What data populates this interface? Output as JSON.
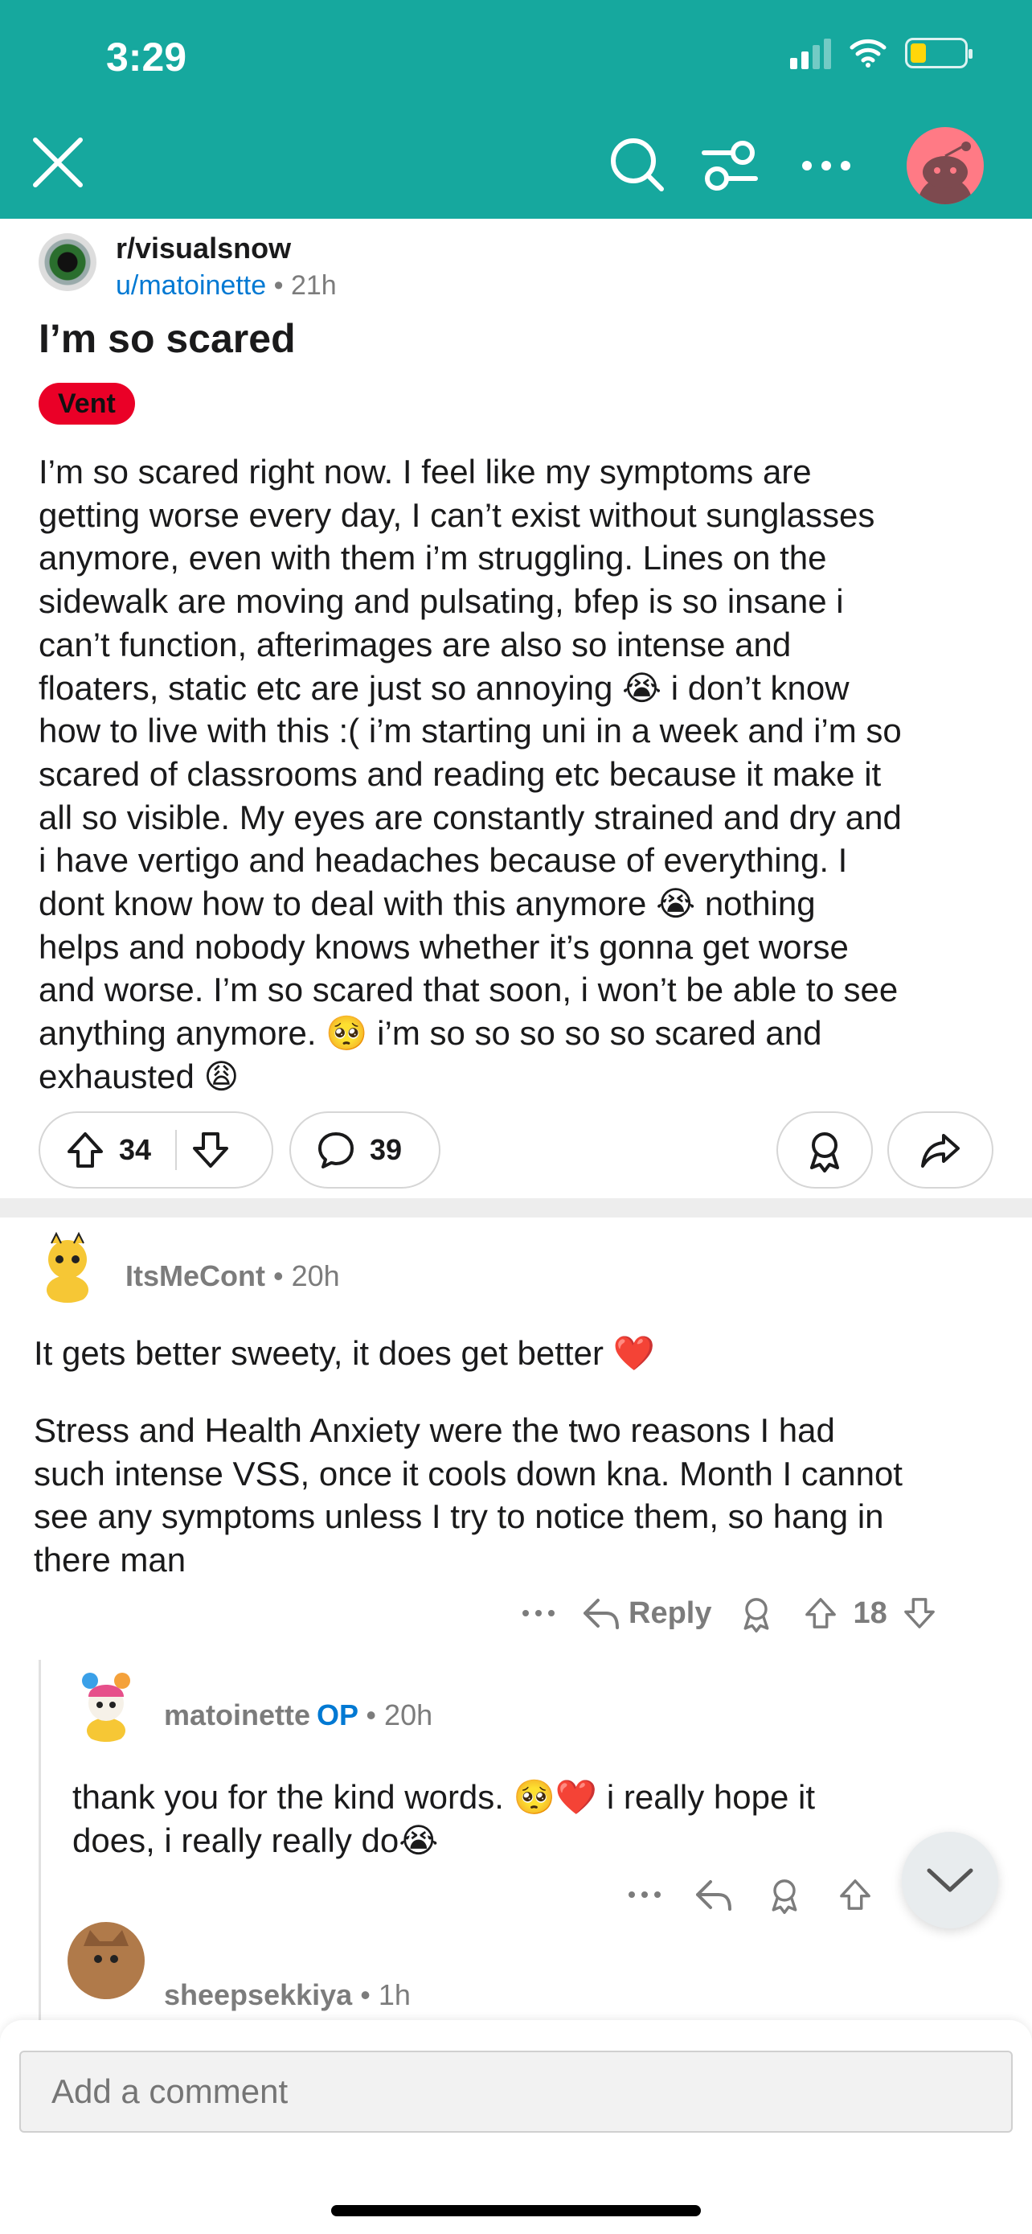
{
  "status_bar": {
    "time": "3:29"
  },
  "post": {
    "subreddit": "r/visualsnow",
    "author": "u/matoinette",
    "separator": "•",
    "age": "21h",
    "title": "I’m so scared",
    "flair": "Vent",
    "body": "I’m so scared right now. I feel like my symptoms are\ngetting worse every day, I can’t exist without sunglasses\nanymore, even with them i’m struggling. Lines on the\nsidewalk are moving and pulsating, bfep is so insane i\ncan’t function, afterimages are also so intense and\nfloaters, static etc are just so annoying 😭 i don’t know\nhow to live with this :( i’m starting uni in a week and i’m so\nscared of classrooms and reading etc because it make it\nall so visible. My eyes are constantly strained and dry and\ni have vertigo and headaches because of everything. I\ndont know how to deal with this anymore 😭 nothing\nhelps and nobody knows whether it’s gonna get worse\nand worse. I’m so scared that soon, i won’t be able to see\nanything anymore. 🥺 i’m so so so so so scared and\nexhausted 😩",
    "votes": "34",
    "comments": "39"
  },
  "comments": [
    {
      "user": "ItsMeCont",
      "separator": "•",
      "age": "20h",
      "body_p1": "It gets better sweety, it does get better ❤️",
      "body_p2": "Stress and Health Anxiety were the two reasons I had\nsuch intense VSS, once it cools down kna. Month I cannot\nsee any symptoms unless I try to notice them, so hang in\nthere man",
      "reply_label": "Reply",
      "votes": "18"
    },
    {
      "user": "matoinette",
      "op_label": "OP",
      "separator": "•",
      "age": "20h",
      "body": "thank you for the kind words. 🥺❤️ i really hope it\ndoes, i really really do😭"
    },
    {
      "user": "sheepsekkiya",
      "separator": "•",
      "age": "1h"
    }
  ],
  "composer": {
    "placeholder": "Add a comment"
  },
  "icons": {
    "close": "close-icon",
    "search": "search-icon",
    "filter": "sort-filter-icon",
    "more": "more-icon",
    "upvote": "upvote-icon",
    "downvote": "downvote-icon",
    "comment": "comment-icon",
    "award": "award-icon",
    "share": "share-icon",
    "reply": "reply-icon",
    "chevron": "chevron-down-icon"
  },
  "colors": {
    "header": "#16a89e",
    "flair": "#ea0027",
    "link": "#0079d3",
    "meta": "#7c7c7c"
  }
}
